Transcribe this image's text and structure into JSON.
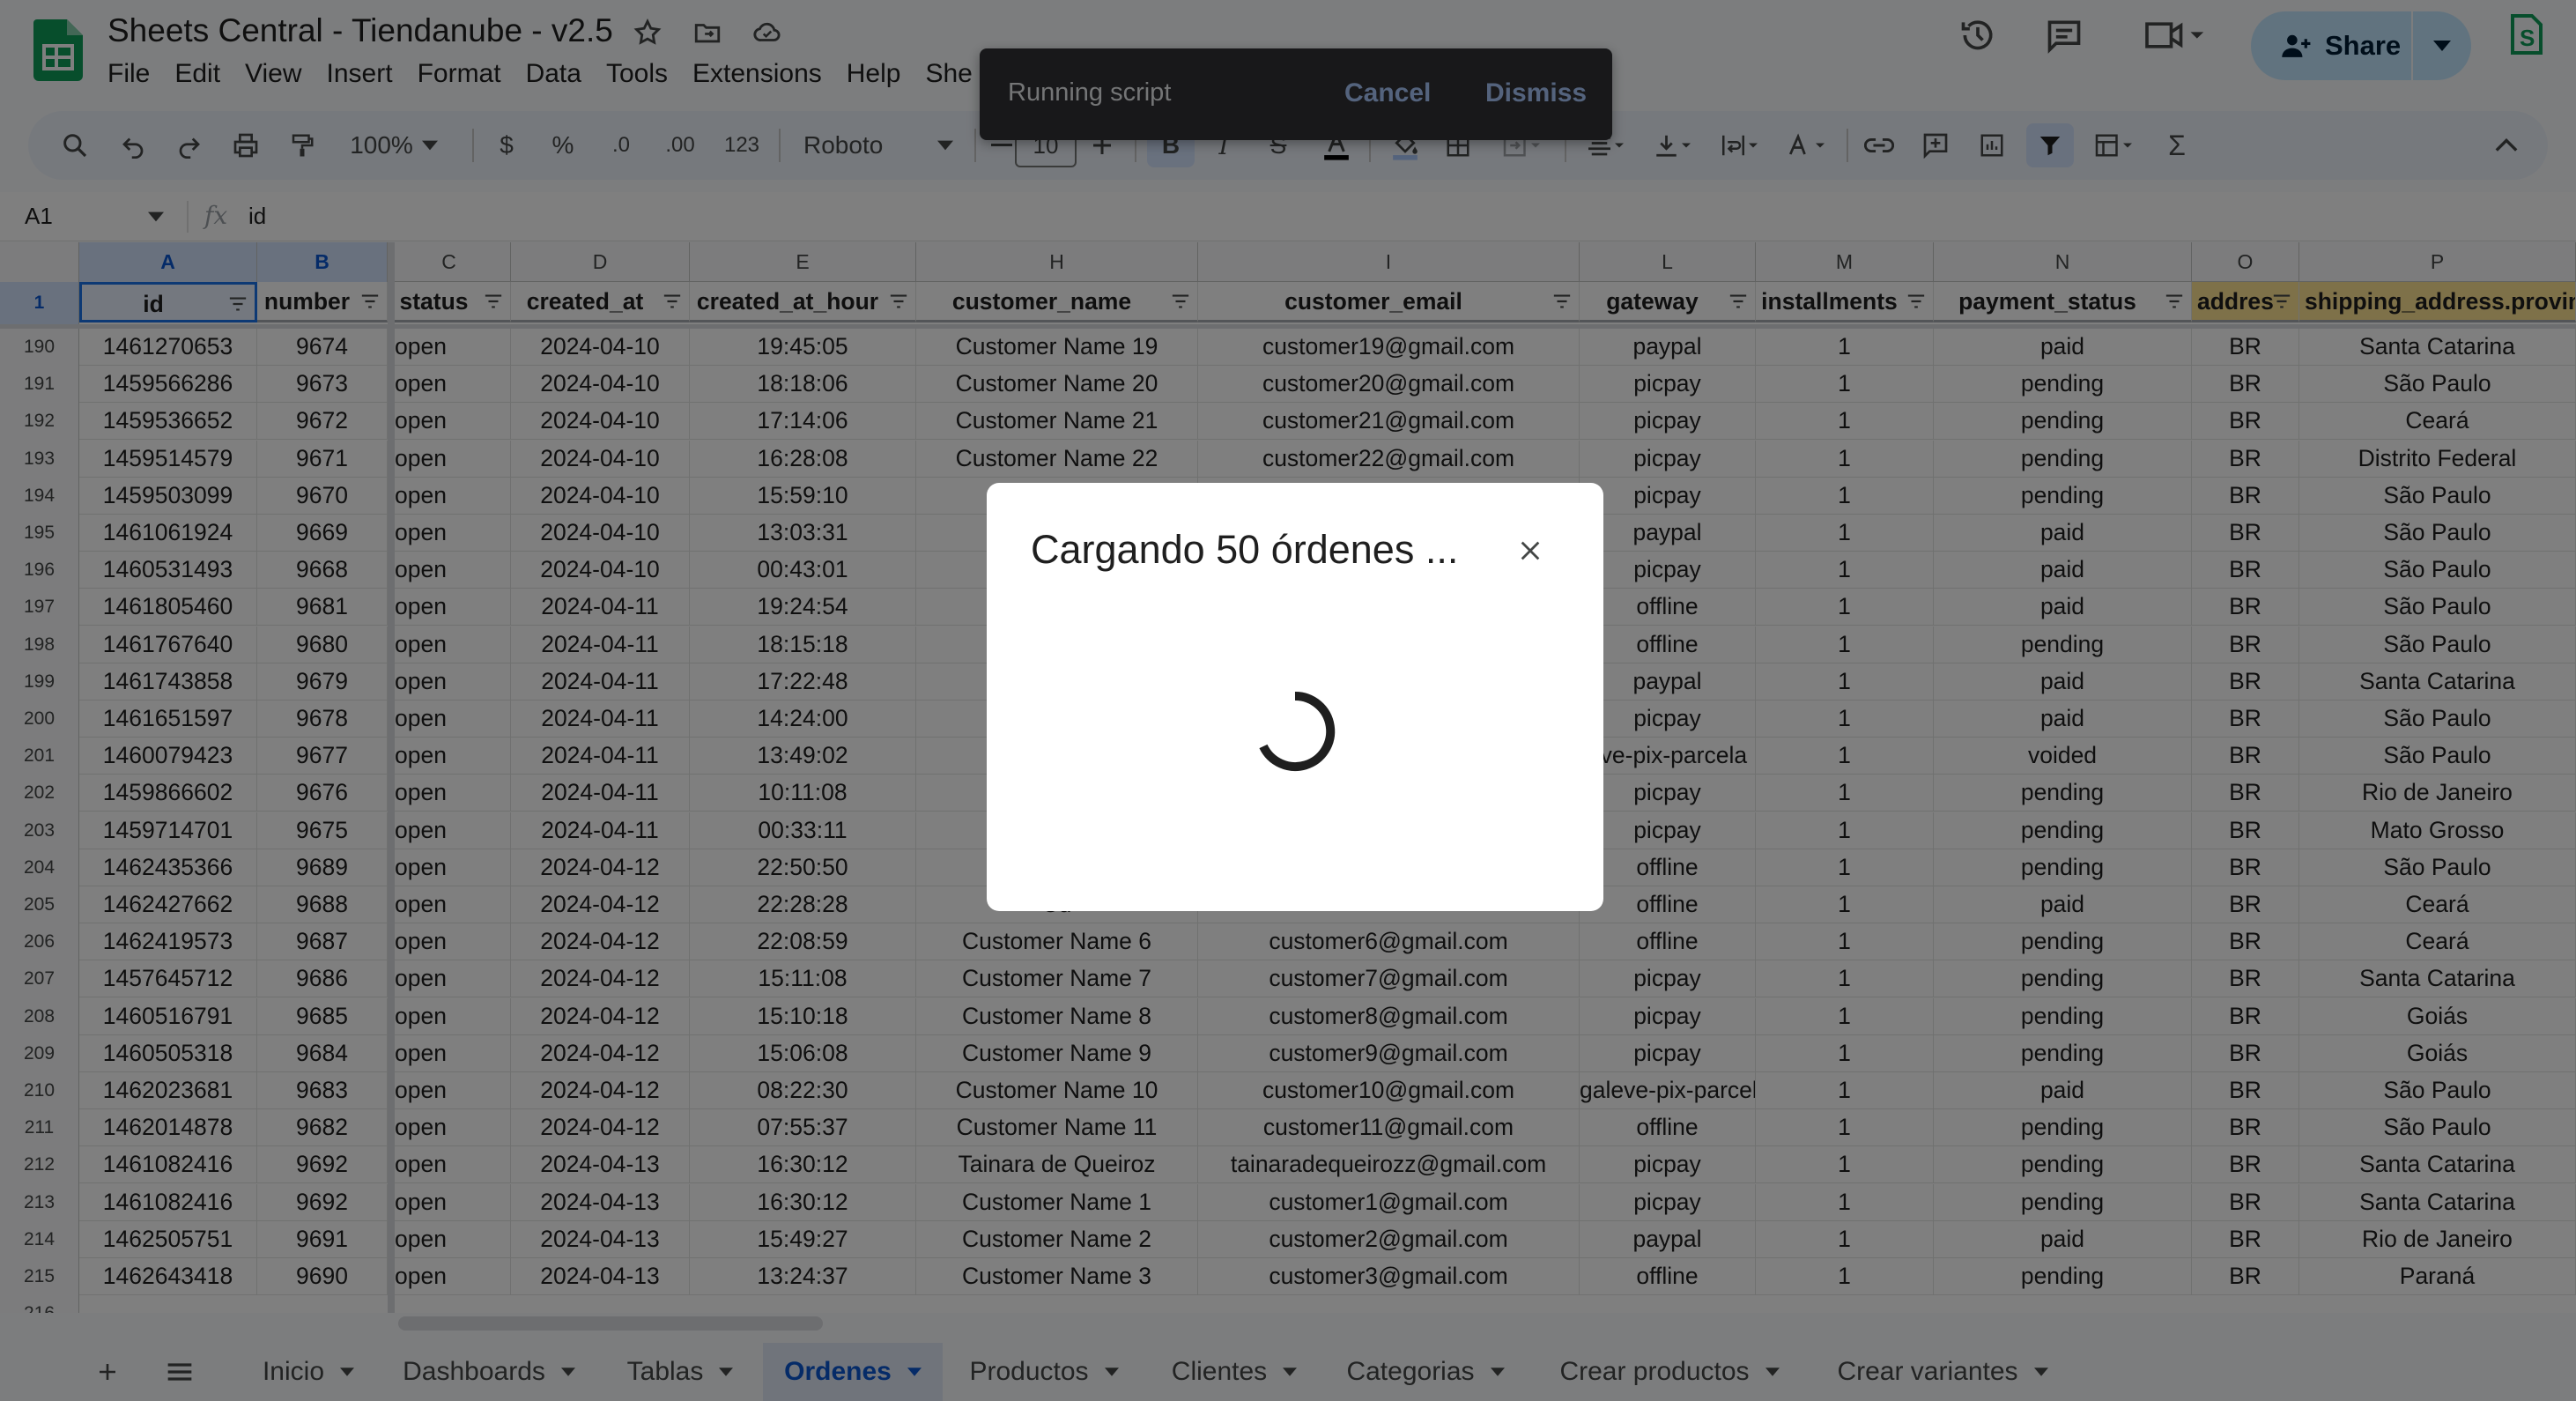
{
  "doc": {
    "title": "Sheets Central - Tiendanube - v2.5",
    "menu": [
      "File",
      "Edit",
      "View",
      "Insert",
      "Format",
      "Data",
      "Tools",
      "Extensions",
      "Help",
      "She"
    ]
  },
  "share": {
    "label": "Share"
  },
  "toolbar": {
    "zoom": "100%",
    "currency": "$",
    "percent": "%",
    "dec_less": ".0",
    "dec_more": ".00",
    "number_format": "123",
    "font": "Roboto",
    "font_size": "10"
  },
  "formula": {
    "cell_ref": "A1",
    "fx": "fx",
    "value": "id"
  },
  "columns": [
    "A",
    "B",
    "C",
    "D",
    "E",
    "H",
    "I",
    "L",
    "M",
    "N",
    "O",
    "P"
  ],
  "header_row_number": "1",
  "headers": [
    "id",
    "number",
    "status",
    "created_at",
    "created_at_hour",
    "customer_name",
    "customer_email",
    "gateway",
    "installments",
    "payment_status",
    "addres",
    "shipping_address.provin"
  ],
  "rows": [
    {
      "n": "190",
      "c": [
        "1461270653",
        "9674",
        "open",
        "2024-04-10",
        "19:45:05",
        "Customer Name 19",
        "customer19@gmail.com",
        "paypal",
        "1",
        "paid",
        "BR",
        "Santa Catarina"
      ]
    },
    {
      "n": "191",
      "c": [
        "1459566286",
        "9673",
        "open",
        "2024-04-10",
        "18:18:06",
        "Customer Name 20",
        "customer20@gmail.com",
        "picpay",
        "1",
        "pending",
        "BR",
        "São Paulo"
      ]
    },
    {
      "n": "192",
      "c": [
        "1459536652",
        "9672",
        "open",
        "2024-04-10",
        "17:14:06",
        "Customer Name 21",
        "customer21@gmail.com",
        "picpay",
        "1",
        "pending",
        "BR",
        "Ceará"
      ]
    },
    {
      "n": "193",
      "c": [
        "1459514579",
        "9671",
        "open",
        "2024-04-10",
        "16:28:08",
        "Customer Name 22",
        "customer22@gmail.com",
        "picpay",
        "1",
        "pending",
        "BR",
        "Distrito Federal"
      ]
    },
    {
      "n": "194",
      "c": [
        "1459503099",
        "9670",
        "open",
        "2024-04-10",
        "15:59:10",
        "Cu",
        "",
        "picpay",
        "1",
        "pending",
        "BR",
        "São Paulo"
      ]
    },
    {
      "n": "195",
      "c": [
        "1461061924",
        "9669",
        "open",
        "2024-04-10",
        "13:03:31",
        "Cu",
        "",
        "paypal",
        "1",
        "paid",
        "BR",
        "São Paulo"
      ]
    },
    {
      "n": "196",
      "c": [
        "1460531493",
        "9668",
        "open",
        "2024-04-10",
        "00:43:01",
        "Cu",
        "",
        "picpay",
        "1",
        "paid",
        "BR",
        "São Paulo"
      ]
    },
    {
      "n": "197",
      "c": [
        "1461805460",
        "9681",
        "open",
        "2024-04-11",
        "19:24:54",
        "Cu",
        "",
        "offline",
        "1",
        "paid",
        "BR",
        "São Paulo"
      ]
    },
    {
      "n": "198",
      "c": [
        "1461767640",
        "9680",
        "open",
        "2024-04-11",
        "18:15:18",
        "Cu",
        "",
        "offline",
        "1",
        "pending",
        "BR",
        "São Paulo"
      ]
    },
    {
      "n": "199",
      "c": [
        "1461743858",
        "9679",
        "open",
        "2024-04-11",
        "17:22:48",
        "Cu",
        "",
        "paypal",
        "1",
        "paid",
        "BR",
        "Santa Catarina"
      ]
    },
    {
      "n": "200",
      "c": [
        "1461651597",
        "9678",
        "open",
        "2024-04-11",
        "14:24:00",
        "Cu",
        "",
        "picpay",
        "1",
        "paid",
        "BR",
        "São Paulo"
      ]
    },
    {
      "n": "201",
      "c": [
        "1460079423",
        "9677",
        "open",
        "2024-04-11",
        "13:49:02",
        "Cu",
        "",
        "eve-pix-parcela",
        "1",
        "voided",
        "BR",
        "São Paulo"
      ]
    },
    {
      "n": "202",
      "c": [
        "1459866602",
        "9676",
        "open",
        "2024-04-11",
        "10:11:08",
        "Cu",
        "",
        "picpay",
        "1",
        "pending",
        "BR",
        "Rio de Janeiro"
      ]
    },
    {
      "n": "203",
      "c": [
        "1459714701",
        "9675",
        "open",
        "2024-04-11",
        "00:33:11",
        "Cu",
        "",
        "picpay",
        "1",
        "pending",
        "BR",
        "Mato Grosso"
      ]
    },
    {
      "n": "204",
      "c": [
        "1462435366",
        "9689",
        "open",
        "2024-04-12",
        "22:50:50",
        "Cu",
        "",
        "offline",
        "1",
        "pending",
        "BR",
        "São Paulo"
      ]
    },
    {
      "n": "205",
      "c": [
        "1462427662",
        "9688",
        "open",
        "2024-04-12",
        "22:28:28",
        "Cu",
        "",
        "offline",
        "1",
        "paid",
        "BR",
        "Ceará"
      ]
    },
    {
      "n": "206",
      "c": [
        "1462419573",
        "9687",
        "open",
        "2024-04-12",
        "22:08:59",
        "Customer Name 6",
        "customer6@gmail.com",
        "offline",
        "1",
        "pending",
        "BR",
        "Ceará"
      ]
    },
    {
      "n": "207",
      "c": [
        "1457645712",
        "9686",
        "open",
        "2024-04-12",
        "15:11:08",
        "Customer Name 7",
        "customer7@gmail.com",
        "picpay",
        "1",
        "pending",
        "BR",
        "Santa Catarina"
      ]
    },
    {
      "n": "208",
      "c": [
        "1460516791",
        "9685",
        "open",
        "2024-04-12",
        "15:10:18",
        "Customer Name 8",
        "customer8@gmail.com",
        "picpay",
        "1",
        "pending",
        "BR",
        "Goiás"
      ]
    },
    {
      "n": "209",
      "c": [
        "1460505318",
        "9684",
        "open",
        "2024-04-12",
        "15:06:08",
        "Customer Name 9",
        "customer9@gmail.com",
        "picpay",
        "1",
        "pending",
        "BR",
        "Goiás"
      ]
    },
    {
      "n": "210",
      "c": [
        "1462023681",
        "9683",
        "open",
        "2024-04-12",
        "08:22:30",
        "Customer Name 10",
        "customer10@gmail.com",
        "galeve-pix-parcela",
        "1",
        "paid",
        "BR",
        "São Paulo"
      ]
    },
    {
      "n": "211",
      "c": [
        "1462014878",
        "9682",
        "open",
        "2024-04-12",
        "07:55:37",
        "Customer Name 11",
        "customer11@gmail.com",
        "offline",
        "1",
        "pending",
        "BR",
        "São Paulo"
      ]
    },
    {
      "n": "212",
      "c": [
        "1461082416",
        "9692",
        "open",
        "2024-04-13",
        "16:30:12",
        "Tainara de Queiroz",
        "tainaradequeirozz@gmail.com",
        "picpay",
        "1",
        "pending",
        "BR",
        "Santa Catarina"
      ]
    },
    {
      "n": "213",
      "c": [
        "1461082416",
        "9692",
        "open",
        "2024-04-13",
        "16:30:12",
        "Customer Name 1",
        "customer1@gmail.com",
        "picpay",
        "1",
        "pending",
        "BR",
        "Santa Catarina"
      ]
    },
    {
      "n": "214",
      "c": [
        "1462505751",
        "9691",
        "open",
        "2024-04-13",
        "15:49:27",
        "Customer Name 2",
        "customer2@gmail.com",
        "paypal",
        "1",
        "paid",
        "BR",
        "Rio de Janeiro"
      ]
    },
    {
      "n": "215",
      "c": [
        "1462643418",
        "9690",
        "open",
        "2024-04-13",
        "13:24:37",
        "Customer Name 3",
        "customer3@gmail.com",
        "offline",
        "1",
        "pending",
        "BR",
        "Paraná"
      ]
    }
  ],
  "last_row_number": "216",
  "sheets": [
    {
      "label": "Inicio",
      "active": false
    },
    {
      "label": "Dashboards",
      "active": false
    },
    {
      "label": "Tablas",
      "active": false
    },
    {
      "label": "Ordenes",
      "active": true
    },
    {
      "label": "Productos",
      "active": false
    },
    {
      "label": "Clientes",
      "active": false
    },
    {
      "label": "Categorias",
      "active": false
    },
    {
      "label": "Crear productos",
      "active": false
    },
    {
      "label": "Crear variantes",
      "active": false
    }
  ],
  "snackbar": {
    "text": "Running script",
    "cancel": "Cancel",
    "dismiss": "Dismiss"
  },
  "dialog": {
    "title": "Cargando 50 órdenes ..."
  },
  "colors": {
    "accent": "#0b57d0",
    "share_bg": "#c2e7ff",
    "sheets_green": "#0f9d58",
    "snackbar_bg": "#303134"
  }
}
